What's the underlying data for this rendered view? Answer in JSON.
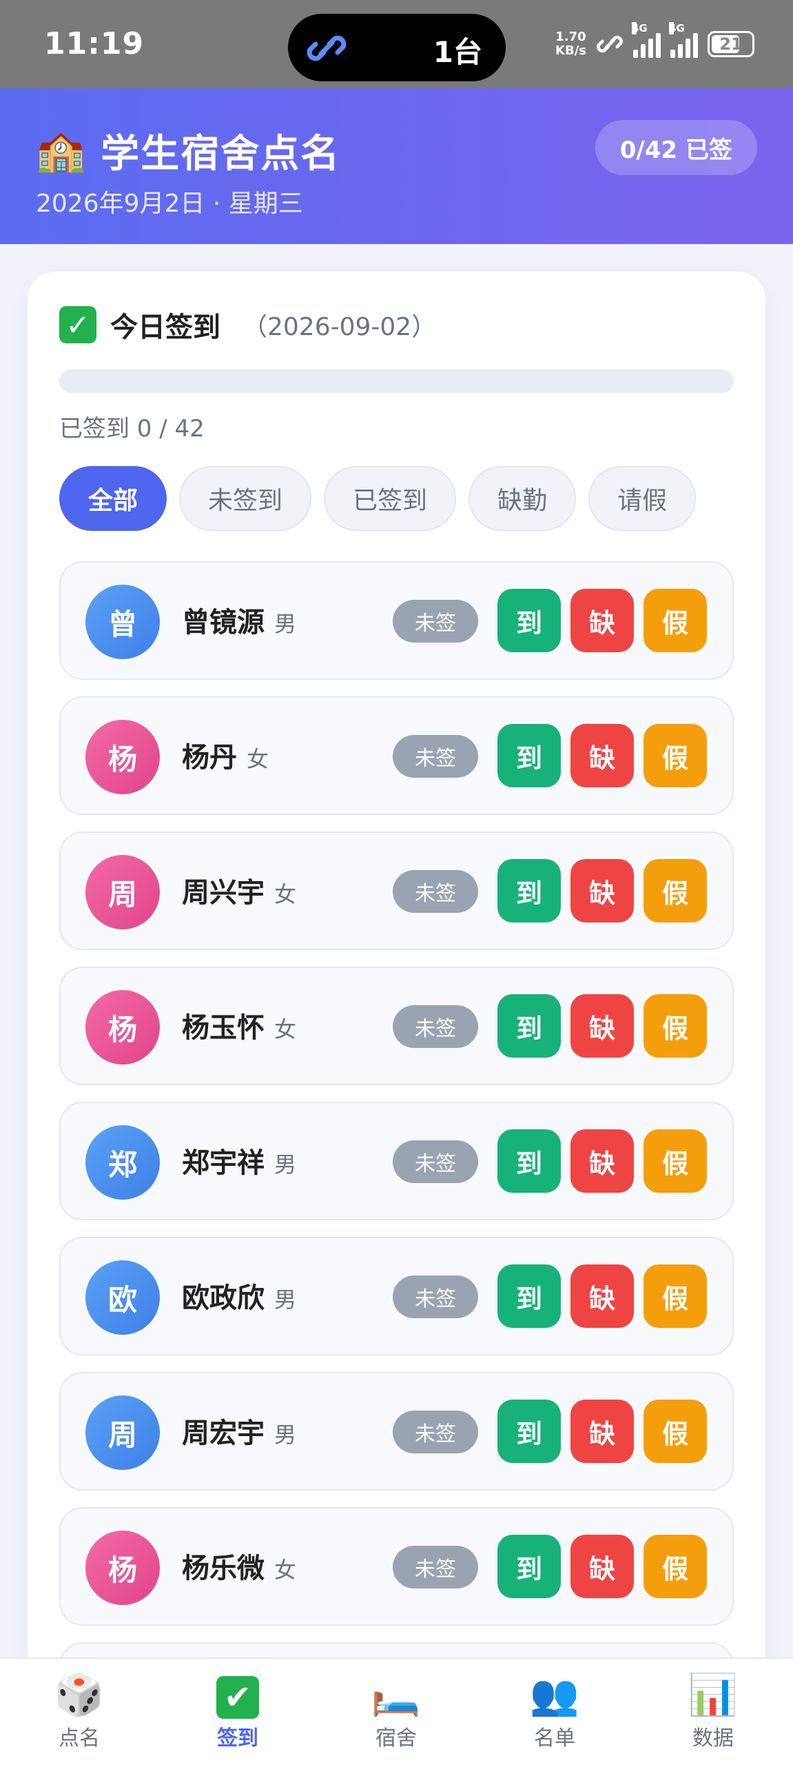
{
  "statusbar": {
    "time": "11:19",
    "pill_text": "1台",
    "speed_top": "1.70",
    "speed_bottom": "KB/s",
    "signal1": "4G",
    "signal2": "4G",
    "battery": "21"
  },
  "header": {
    "icon": "🏫",
    "title": "学生宿舍点名",
    "date": "2026年9月2日 · 星期三",
    "badge": "0/42 已签"
  },
  "card": {
    "title": "今日签到",
    "date": "（2026-09-02）",
    "progress_text": "已签到 0 / 42",
    "progress_fraction": 0
  },
  "filters": [
    "全部",
    "未签到",
    "已签到",
    "缺勤",
    "请假"
  ],
  "actions": {
    "present": "到",
    "absent": "缺",
    "leave": "假"
  },
  "students": [
    {
      "initial": "曾",
      "name": "曾镜源",
      "gender": "男",
      "status": "未签"
    },
    {
      "initial": "杨",
      "name": "杨丹",
      "gender": "女",
      "status": "未签"
    },
    {
      "initial": "周",
      "name": "周兴宇",
      "gender": "女",
      "status": "未签"
    },
    {
      "initial": "杨",
      "name": "杨玉怀",
      "gender": "女",
      "status": "未签"
    },
    {
      "initial": "郑",
      "name": "郑宇祥",
      "gender": "男",
      "status": "未签"
    },
    {
      "initial": "欧",
      "name": "欧政欣",
      "gender": "男",
      "status": "未签"
    },
    {
      "initial": "周",
      "name": "周宏宇",
      "gender": "男",
      "status": "未签"
    },
    {
      "initial": "杨",
      "name": "杨乐微",
      "gender": "女",
      "status": "未签"
    }
  ],
  "nav": [
    {
      "icon": "🎲",
      "label": "点名"
    },
    {
      "icon": "✔",
      "label": "签到"
    },
    {
      "icon": "🛏️",
      "label": "宿舍"
    },
    {
      "icon": "👥",
      "label": "名单"
    },
    {
      "icon": "📊",
      "label": "数据"
    }
  ]
}
